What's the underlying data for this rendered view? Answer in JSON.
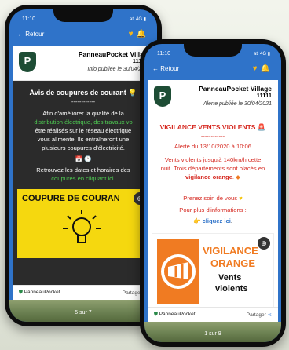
{
  "back_phone": {
    "time": "11:10",
    "signal": "atl 4G ▮",
    "back_label": "← Retour",
    "village_name": "PanneauPocket Villag",
    "village_number": "11111",
    "published": "Info publiée le 30/04/202",
    "title": "Avis de coupures de courant",
    "separator": "------------",
    "body_lines": [
      "Afin d'améliorer la qualité de la",
      "distribution électrique, des travaux vo",
      "être réalisés sur le réseau électrique",
      "vous alimente. Ils entraîneront une",
      "plusieurs coupures d'électricité."
    ],
    "schedule_lines": [
      "Retrouvez les dates et horaires des",
      "coupures en cliquant ici."
    ],
    "banner_text": "COUPURE DE COURAN",
    "footer_brand": "PanneauPocket",
    "footer_share": "Partager",
    "pager": "5 sur 7"
  },
  "front_phone": {
    "time": "11:10",
    "signal": "atl 4G ▮",
    "back_label": "← Retour",
    "village_name": "PanneauPocket Village",
    "village_number": "11111",
    "published": "Alerte publiée le 30/04/2021",
    "title": "VIGILANCE VENTS VIOLENTS",
    "separator": "------------",
    "alert_date": "Alerte du 13/10/2020 à 10:06",
    "body_lines": [
      "Vents violents jusqu'à 140km/h cette",
      "nuit. Trois départements sont placés en"
    ],
    "vigilance_text": "vigilance orange",
    "care_text": "Prenez soin de vous",
    "info_text": "Pour plus d'informations :",
    "link_text": "cliquez ici",
    "poster_line1": "VIGILANCE",
    "poster_line2": "ORANGE",
    "poster_line3": "Vents",
    "poster_line4": "violents",
    "footer_brand": "PanneauPocket",
    "footer_share": "Partager",
    "pager": "1 sur 9"
  },
  "colors": {
    "brand_blue": "#2f73c9",
    "green": "#1e4d35",
    "alert_red": "#d62a22",
    "orange": "#f07b22",
    "yellow": "#f5d80f"
  }
}
